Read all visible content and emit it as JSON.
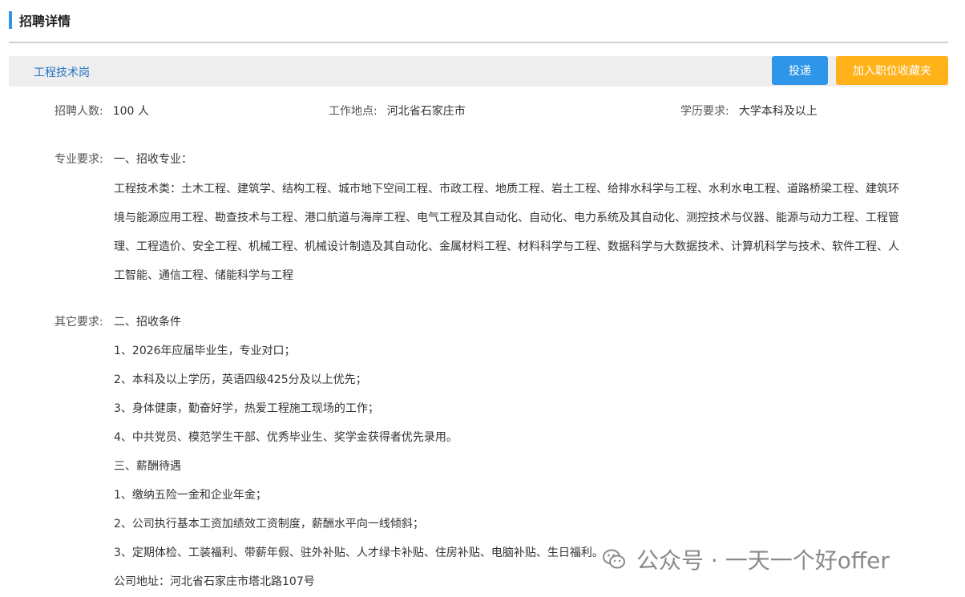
{
  "header": {
    "title": "招聘详情"
  },
  "job_bar": {
    "job_name": "工程技术岗",
    "apply_label": "投递",
    "favorite_label": "加入职位收藏夹"
  },
  "summary": {
    "headcount_label": "招聘人数:",
    "headcount_value": "100 人",
    "location_label": "工作地点:",
    "location_value": "河北省石家庄市",
    "education_label": "学历要求:",
    "education_value": "大学本科及以上"
  },
  "major_requirements": {
    "label": "专业要求:",
    "heading": "一、招收专业：",
    "lines": [
      "工程技术类：土木工程、建筑学、结构工程、城市地下空间工程、市政工程、地质工程、岩土工程、给排水科学与工程、水利水电工程、道路桥梁工程、建筑环",
      "境与能源应用工程、勘查技术与工程、港口航道与海岸工程、电气工程及其自动化、自动化、电力系统及其自动化、测控技术与仪器、能源与动力工程、工程管",
      "理、工程造价、安全工程、机械工程、机械设计制造及其自动化、金属材料工程、材料科学与工程、数据科学与大数据技术、计算机科学与技术、软件工程、人",
      "工智能、通信工程、储能科学与工程"
    ]
  },
  "other_requirements": {
    "label": "其它要求:",
    "heading": "二、招收条件",
    "lines": [
      "1、2026年应届毕业生，专业对口；",
      "2、本科及以上学历，英语四级425分及以上优先；",
      "3、身体健康，勤奋好学，热爱工程施工现场的工作；",
      "4、中共党员、模范学生干部、优秀毕业生、奖学金获得者优先录用。",
      "三、薪酬待遇",
      "1、缴纳五险一金和企业年金；",
      "2、公司执行基本工资加绩效工资制度，薪酬水平向一线倾斜；",
      "3、定期体检、工装福利、带薪年假、驻外补贴、人才绿卡补贴、住房补贴、电脑补贴、生日福利。",
      "公司地址：河北省石家庄市塔北路107号"
    ]
  },
  "watermark": {
    "text": "公众号 · 一天一个好offer",
    "icon": "wechat-icon"
  },
  "colors": {
    "accent_blue": "#2f95e8",
    "accent_orange": "#ffb21a",
    "link_blue": "#2372c4"
  }
}
